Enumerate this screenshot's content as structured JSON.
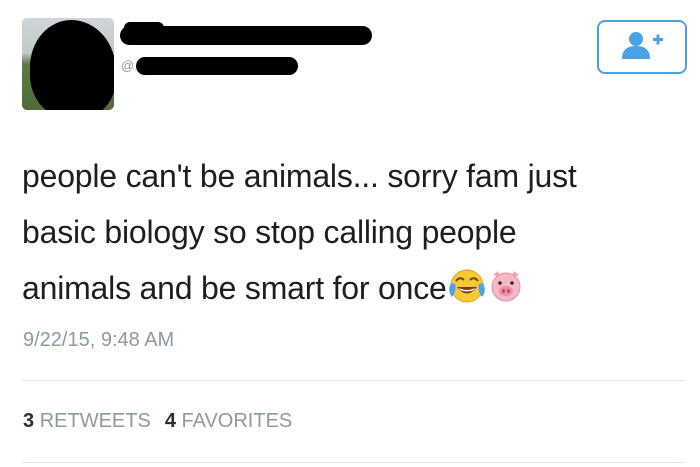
{
  "profile": {
    "handle_prefix": "@",
    "follow_button_icon": "follow-user-plus-icon",
    "accent_color": "#4aa3e0"
  },
  "tweet": {
    "line1": "people can't be animals... sorry fam just",
    "line2": "basic biology so stop calling people",
    "line3": "animals and be smart for once",
    "emojis": [
      "face-with-tears-of-joy-emoji",
      "pig-face-emoji"
    ],
    "timestamp": "9/22/15, 9:48 AM"
  },
  "stats": {
    "retweets_count": "3",
    "retweets_label": "RETWEETS",
    "favorites_count": "4",
    "favorites_label": "FAVORITES"
  }
}
